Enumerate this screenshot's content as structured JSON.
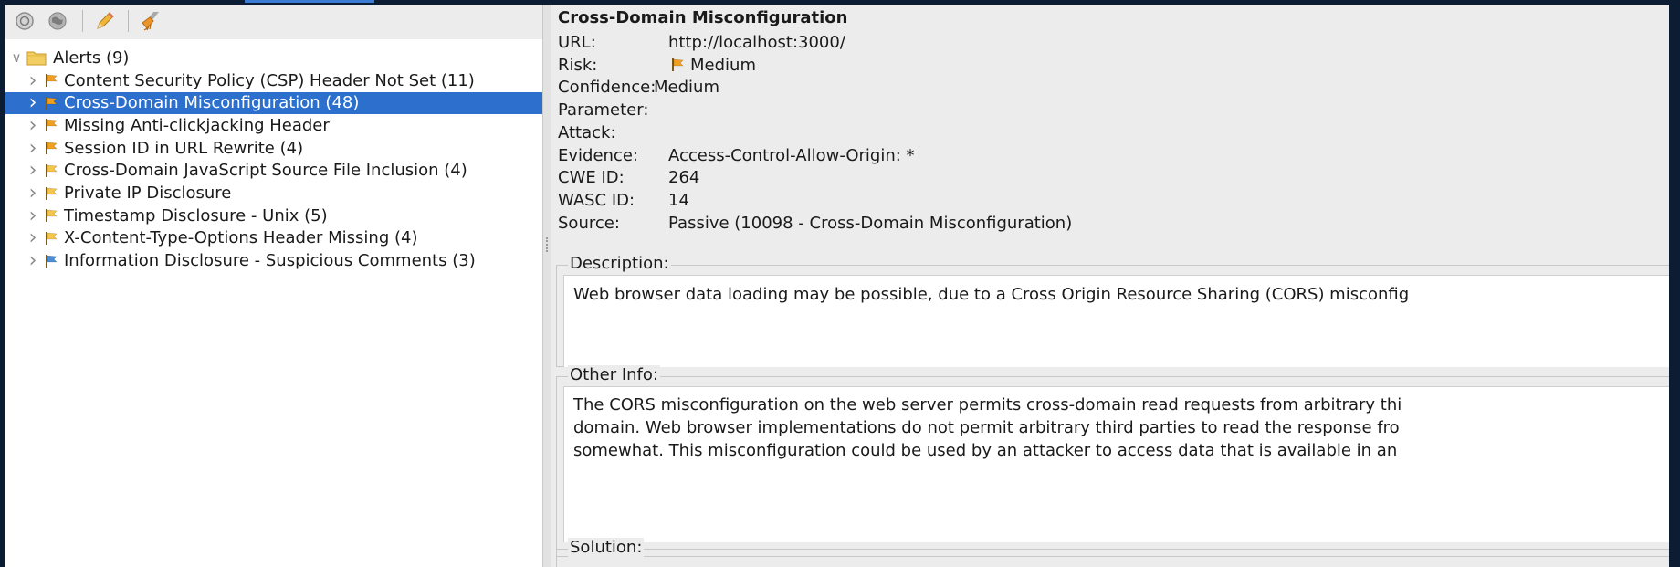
{
  "colors": {
    "selection": "#2c6fcc",
    "flag_high": "#f2a40f",
    "flag_medium": "#f0a020",
    "flag_low": "#f6c649",
    "flag_info": "#4b8ed8"
  },
  "toolbar": {
    "icons": [
      "broken-link-icon",
      "globe-icon",
      "pencil-icon",
      "broom-icon"
    ]
  },
  "alerts_tree": {
    "root_label": "Alerts (9)",
    "items": [
      {
        "label": "Content Security Policy (CSP) Header Not Set (11)",
        "risk": "medium"
      },
      {
        "label": "Cross-Domain Misconfiguration (48)",
        "risk": "medium",
        "selected": true
      },
      {
        "label": "Missing Anti-clickjacking Header",
        "risk": "medium"
      },
      {
        "label": "Session ID in URL Rewrite (4)",
        "risk": "medium"
      },
      {
        "label": "Cross-Domain JavaScript Source File Inclusion (4)",
        "risk": "low"
      },
      {
        "label": "Private IP Disclosure",
        "risk": "low"
      },
      {
        "label": "Timestamp Disclosure - Unix (5)",
        "risk": "low"
      },
      {
        "label": "X-Content-Type-Options Header Missing (4)",
        "risk": "low"
      },
      {
        "label": "Information Disclosure - Suspicious Comments (3)",
        "risk": "info"
      }
    ]
  },
  "details": {
    "title": "Cross-Domain Misconfiguration",
    "fields": [
      {
        "label": "URL:",
        "value": "http://localhost:3000/"
      },
      {
        "label": "Risk:",
        "value": "Medium",
        "flag": true
      },
      {
        "label": "Confidence:",
        "value": "Medium",
        "inline": true
      },
      {
        "label": "Parameter:",
        "value": ""
      },
      {
        "label": "Attack:",
        "value": ""
      },
      {
        "label": "Evidence:",
        "value": "Access-Control-Allow-Origin: *"
      },
      {
        "label": "CWE ID:",
        "value": "264"
      },
      {
        "label": "WASC ID:",
        "value": "14"
      },
      {
        "label": "Source:",
        "value": "Passive (10098 - Cross-Domain Misconfiguration)"
      }
    ],
    "description": {
      "label": "Description:",
      "text": "Web browser data loading may be possible, due to a Cross Origin Resource Sharing (CORS) misconfig"
    },
    "other_info": {
      "label": "Other Info:",
      "lines": [
        "The CORS misconfiguration on the web server permits cross-domain read requests from arbitrary thi",
        "domain. Web browser implementations do not permit arbitrary third parties to read the response fro",
        "somewhat. This misconfiguration could be used by an attacker to access data that is available in an"
      ]
    },
    "solution": {
      "label": "Solution:"
    }
  }
}
